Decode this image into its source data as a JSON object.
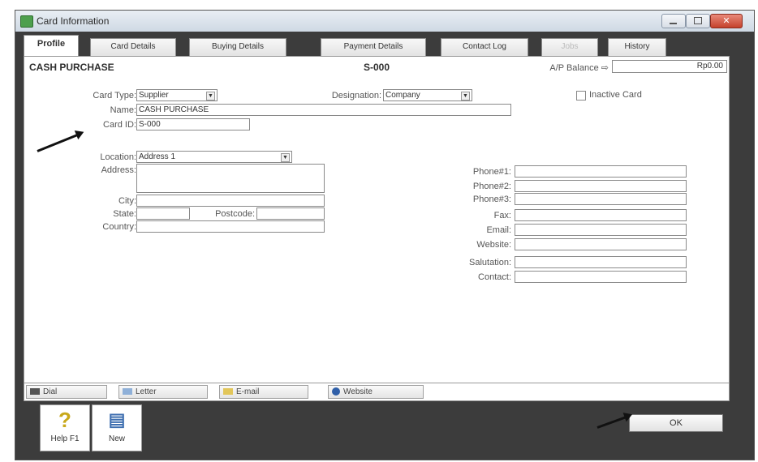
{
  "window": {
    "title": "Card Information"
  },
  "tabs": [
    {
      "label": "Profile"
    },
    {
      "label": "Card Details"
    },
    {
      "label": "Buying Details"
    },
    {
      "label": "Payment Details"
    },
    {
      "label": "Contact Log"
    },
    {
      "label": "Jobs"
    },
    {
      "label": "History"
    }
  ],
  "header": {
    "card_name": "CASH PURCHASE",
    "card_code": "S-000",
    "balance_label": "A/P Balance ⇨",
    "balance_value": "Rp0.00"
  },
  "form": {
    "card_type_label": "Card Type:",
    "card_type_value": "Supplier",
    "designation_label": "Designation:",
    "designation_value": "Company",
    "inactive_label": "Inactive Card",
    "name_label": "Name:",
    "name_value": "CASH PURCHASE",
    "card_id_label": "Card ID:",
    "card_id_value": "S-000",
    "location_label": "Location:",
    "location_value": "Address 1",
    "address_label": "Address:",
    "city_label": "City:",
    "state_label": "State:",
    "postcode_label": "Postcode:",
    "country_label": "Country:",
    "phone1_label": "Phone#1:",
    "phone2_label": "Phone#2:",
    "phone3_label": "Phone#3:",
    "fax_label": "Fax:",
    "email_label": "Email:",
    "website_label": "Website:",
    "salutation_label": "Salutation:",
    "contact_label": "Contact:"
  },
  "bottom_buttons": [
    {
      "label": "Dial"
    },
    {
      "label": "Letter"
    },
    {
      "label": "E-mail"
    },
    {
      "label": "Website"
    }
  ],
  "toolbar": {
    "help_label": "Help F1",
    "new_label": "New",
    "ok_label": "OK"
  }
}
